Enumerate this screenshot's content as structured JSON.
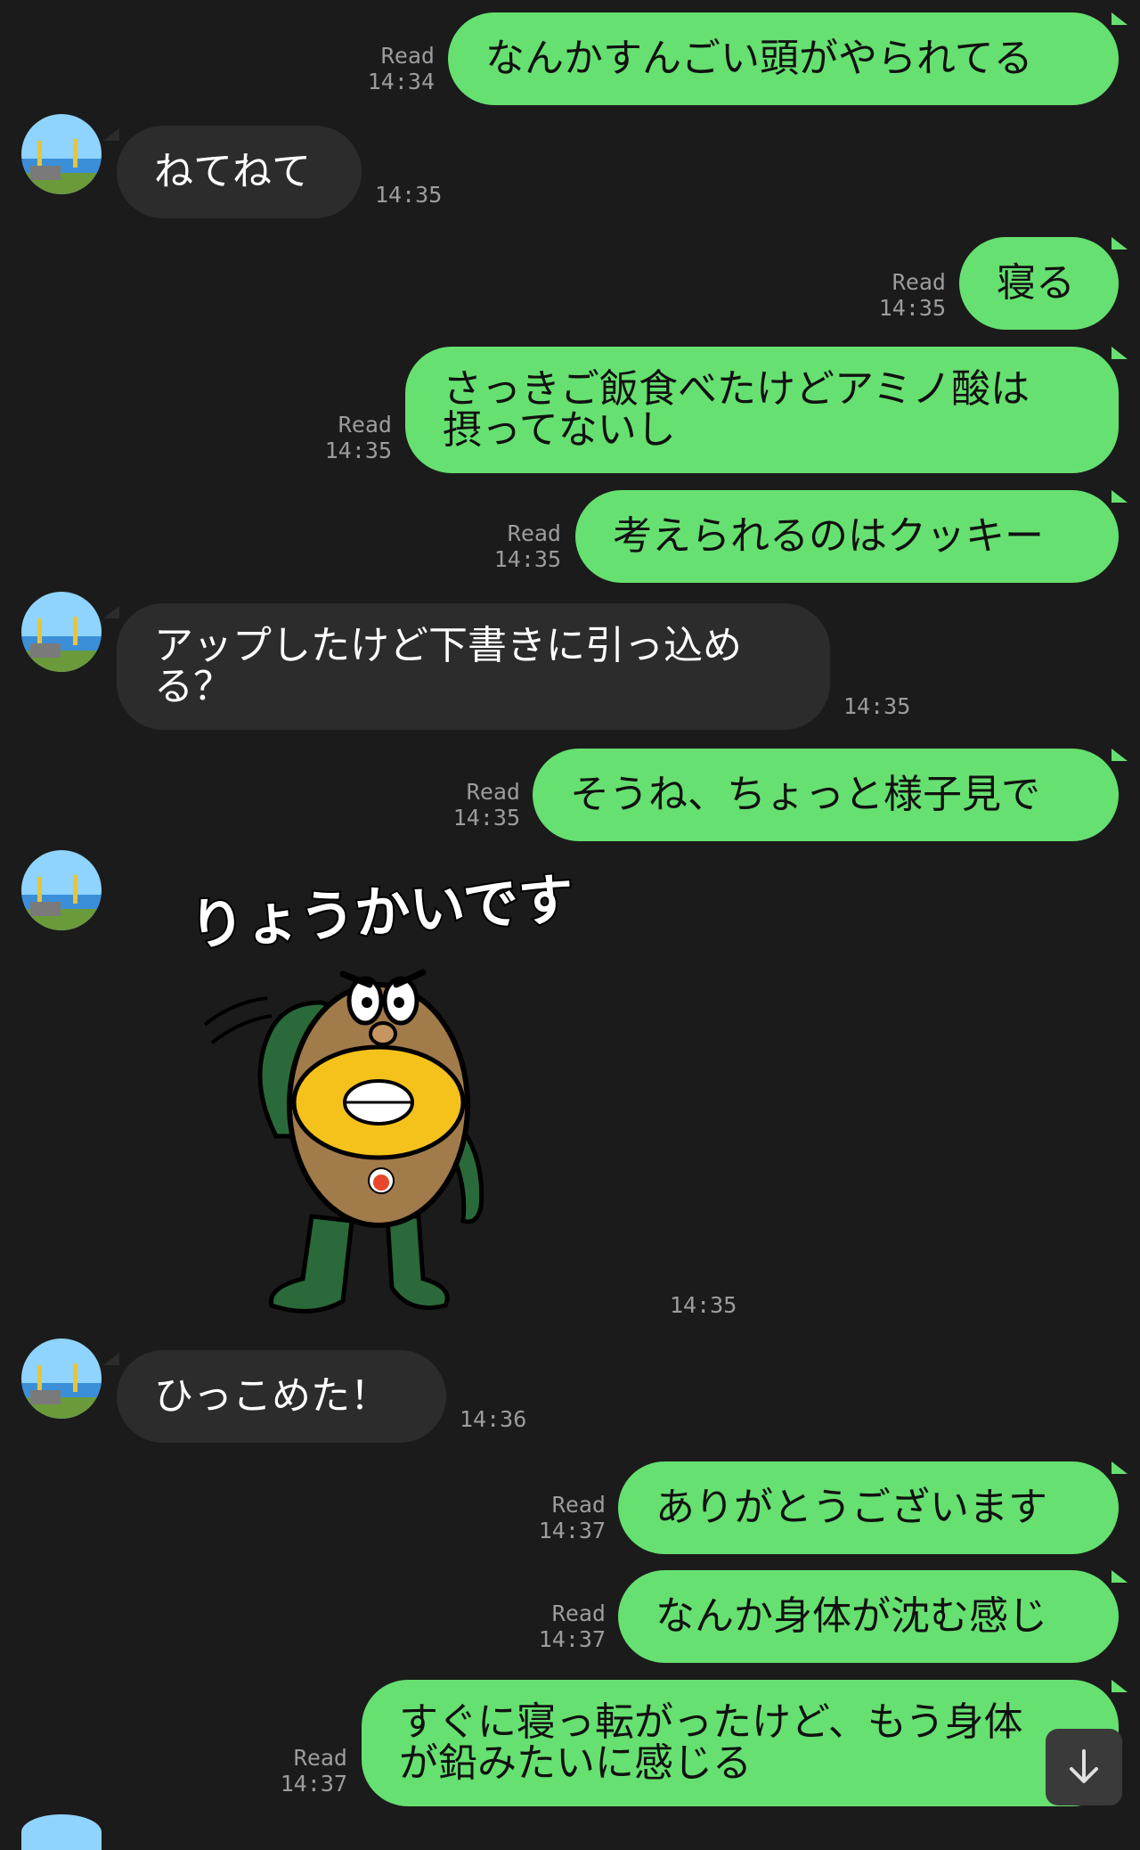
{
  "chat": {
    "messages": [
      {
        "dir": "out",
        "text": "なんかすんごい頭がやられてる",
        "status": "Read",
        "time": "14:34"
      },
      {
        "dir": "in",
        "text": "ねてねて",
        "time": "14:35"
      },
      {
        "dir": "out",
        "text": "寝る",
        "status": "Read",
        "time": "14:35"
      },
      {
        "dir": "out",
        "text": "さっきご飯食べたけどアミノ酸は\n摂ってないし",
        "status": "Read",
        "time": "14:35"
      },
      {
        "dir": "out",
        "text": "考えられるのはクッキー",
        "status": "Read",
        "time": "14:35"
      },
      {
        "dir": "in",
        "text": "アップしたけど下書きに引っ込め\nる？",
        "time": "14:35"
      },
      {
        "dir": "out",
        "text": "そうね、ちょっと様子見で",
        "status": "Read",
        "time": "14:35"
      },
      {
        "dir": "in",
        "type": "sticker",
        "sticker_text": "りょうかいです",
        "time": "14:35"
      },
      {
        "dir": "in",
        "text": "ひっこめた！",
        "time": "14:36"
      },
      {
        "dir": "out",
        "text": "ありがとうございます",
        "status": "Read",
        "time": "14:37"
      },
      {
        "dir": "out",
        "text": "なんか身体が沈む感じ",
        "status": "Read",
        "time": "14:37"
      },
      {
        "dir": "out",
        "text": "すぐに寝っ転がったけど、もう身体\nが鉛みたいに感じる",
        "status": "Read",
        "time": "14:37"
      }
    ]
  },
  "colors": {
    "background": "#1b1b1b",
    "outgoing_bubble": "#66e070",
    "incoming_bubble": "#2c2c2c",
    "meta_text": "#9c9c9c"
  },
  "icons": {
    "scroll_down": "arrow-down-icon",
    "avatar": "contact-avatar"
  }
}
